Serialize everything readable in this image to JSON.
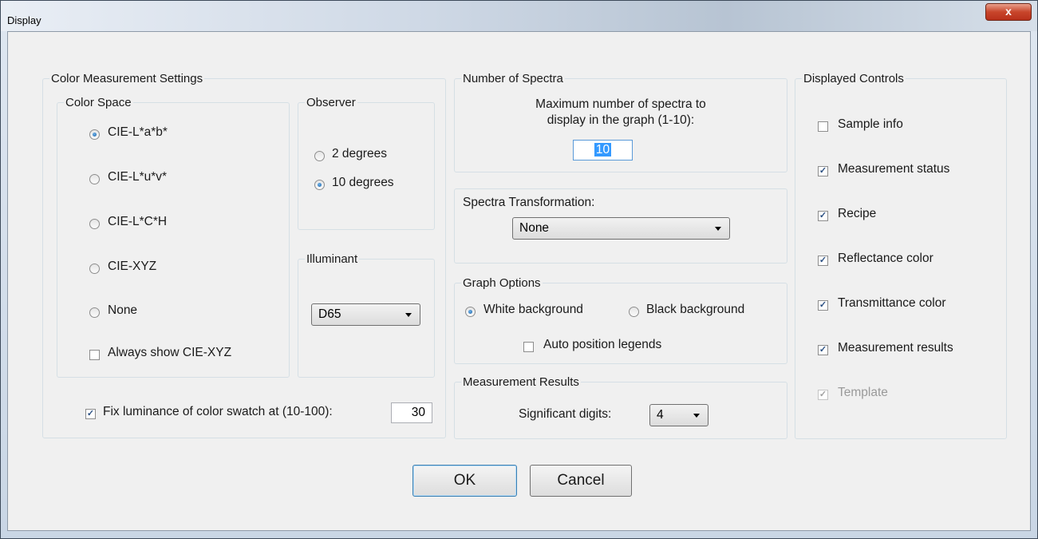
{
  "window": {
    "title": "Display",
    "close_glyph": "x"
  },
  "color_measurement": {
    "title": "Color Measurement Settings",
    "color_space": {
      "title": "Color Space",
      "options": [
        {
          "label": "CIE-L*a*b*",
          "selected": true
        },
        {
          "label": "CIE-L*u*v*",
          "selected": false
        },
        {
          "label": "CIE-L*C*H",
          "selected": false
        },
        {
          "label": "CIE-XYZ",
          "selected": false
        },
        {
          "label": "None",
          "selected": false
        }
      ],
      "always_show_xyz": {
        "label": "Always show CIE-XYZ",
        "checked": false
      }
    },
    "observer": {
      "title": "Observer",
      "options": [
        {
          "label": "2 degrees",
          "selected": false
        },
        {
          "label": "10 degrees",
          "selected": true
        }
      ]
    },
    "illuminant": {
      "title": "Illuminant",
      "value": "D65"
    },
    "fix_luminance": {
      "label": "Fix luminance of color swatch at (10-100):",
      "checked": true,
      "value": "30"
    }
  },
  "number_of_spectra": {
    "title": "Number of Spectra",
    "line1": "Maximum number of spectra to",
    "line2": "display in the graph (1-10):",
    "value": "10"
  },
  "spectra_transformation": {
    "title": "Spectra Transformation:",
    "value": "None"
  },
  "graph_options": {
    "title": "Graph Options",
    "white_bg": {
      "label": "White background",
      "selected": true
    },
    "black_bg": {
      "label": "Black background",
      "selected": false
    },
    "auto_legends": {
      "label": "Auto position legends",
      "checked": false
    }
  },
  "measurement_results": {
    "title": "Measurement Results",
    "label": "Significant digits:",
    "value": "4"
  },
  "displayed_controls": {
    "title": "Displayed Controls",
    "items": [
      {
        "label": "Sample info",
        "checked": false,
        "enabled": true
      },
      {
        "label": "Measurement status",
        "checked": true,
        "enabled": true
      },
      {
        "label": "Recipe",
        "checked": true,
        "enabled": true
      },
      {
        "label": "Reflectance color",
        "checked": true,
        "enabled": true
      },
      {
        "label": "Transmittance color",
        "checked": true,
        "enabled": true
      },
      {
        "label": "Measurement results",
        "checked": true,
        "enabled": true
      },
      {
        "label": "Template",
        "checked": true,
        "enabled": false
      }
    ]
  },
  "buttons": {
    "ok": "OK",
    "cancel": "Cancel"
  }
}
